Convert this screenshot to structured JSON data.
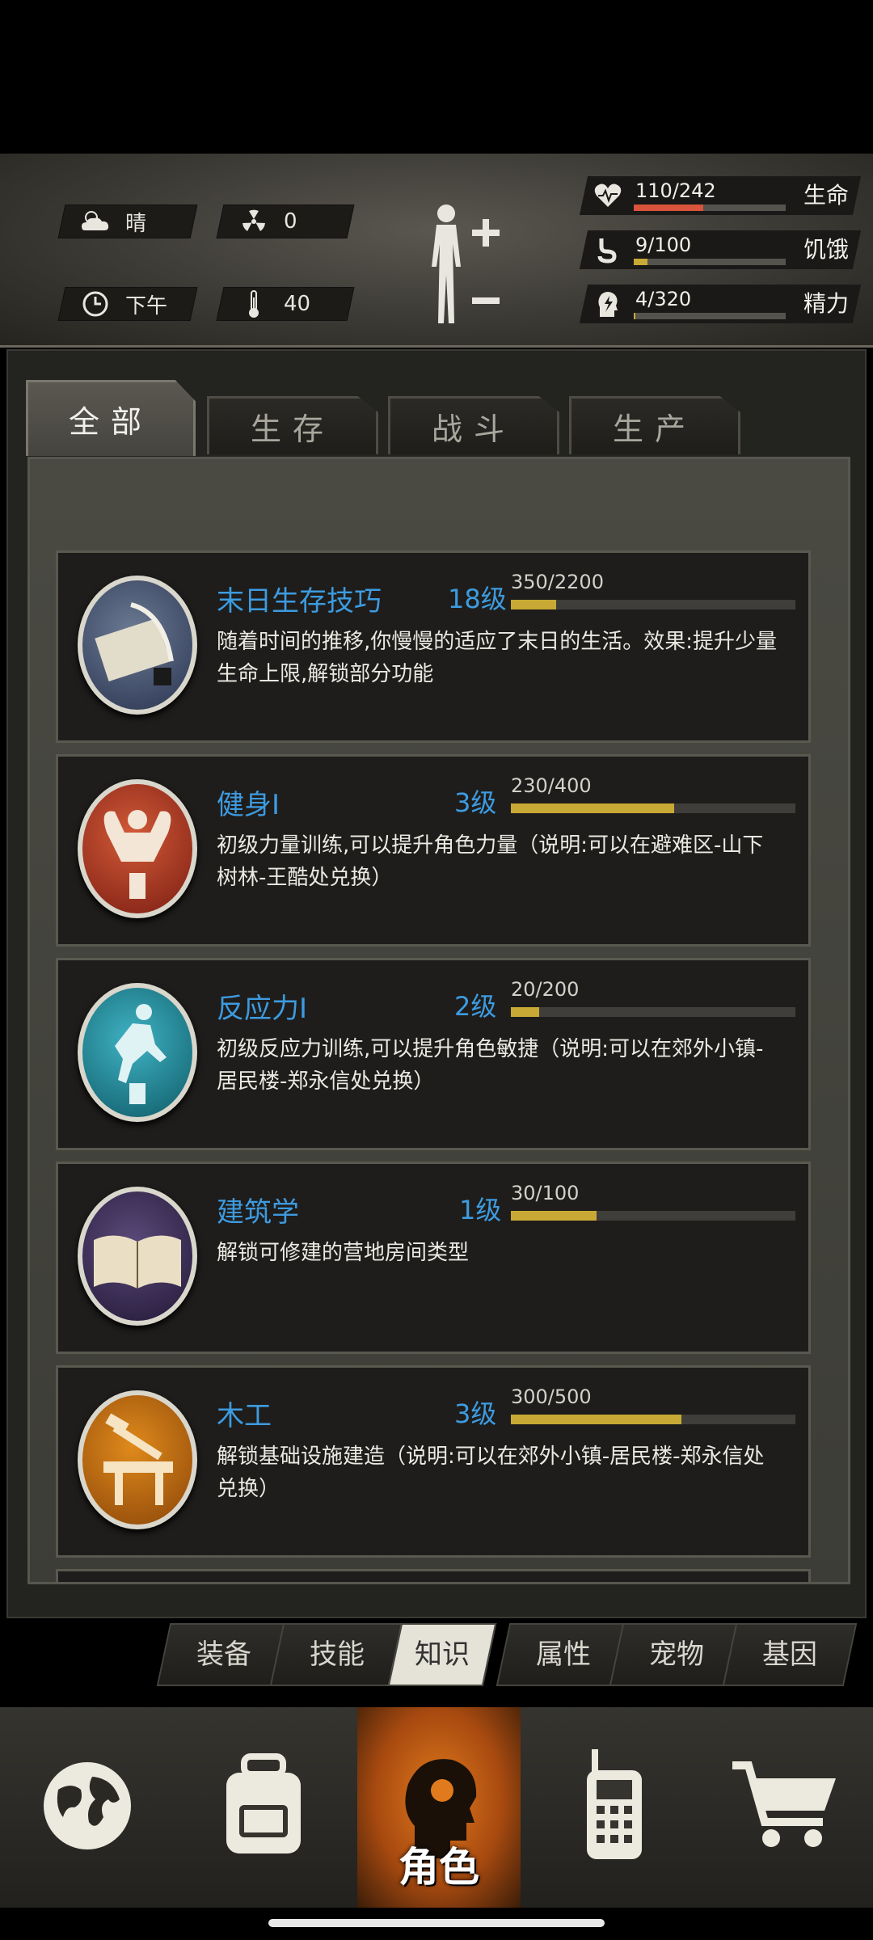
{
  "status": {
    "weather": "晴",
    "radiation": "0",
    "time_of_day": "下午",
    "temperature": "40"
  },
  "vitals": [
    {
      "label": "生命",
      "value": "110/242",
      "ratio": 0.455,
      "color": "#d9533d",
      "icon": "heart-pulse-icon"
    },
    {
      "label": "饥饿",
      "value": "9/100",
      "ratio": 0.09,
      "color": "#c9a935",
      "icon": "stomach-icon"
    },
    {
      "label": "精力",
      "value": "4/320",
      "ratio": 0.0125,
      "color": "#c9a935",
      "icon": "energy-head-icon"
    }
  ],
  "tabs": [
    "全部",
    "生存",
    "战斗",
    "生产"
  ],
  "active_tab": 0,
  "skills": [
    {
      "name": "末日生存技巧",
      "level": "18级",
      "exp": "350/2200",
      "ratio": 0.159,
      "desc": "随着时间的推移,你慢慢的适应了末日的生活。效果:提升少量生命上限,解锁部分功能",
      "icon": "scroll-quill-icon"
    },
    {
      "name": "健身Ⅰ",
      "level": "3级",
      "exp": "230/400",
      "ratio": 0.575,
      "desc": "初级力量训练,可以提升角色力量（说明:可以在避难区-山下树林-王酷处兑换）",
      "icon": "muscle-icon"
    },
    {
      "name": "反应力Ⅰ",
      "level": "2级",
      "exp": "20/200",
      "ratio": 0.1,
      "desc": "初级反应力训练,可以提升角色敏捷（说明:可以在郊外小镇-居民楼-郑永信处兑换）",
      "icon": "agility-icon"
    },
    {
      "name": "建筑学",
      "level": "1级",
      "exp": "30/100",
      "ratio": 0.3,
      "desc": "解锁可修建的营地房间类型",
      "icon": "blueprint-book-icon"
    },
    {
      "name": "木工",
      "level": "3级",
      "exp": "300/500",
      "ratio": 0.6,
      "desc": "解锁基础设施建造（说明:可以在郊外小镇-居民楼-郑永信处兑换）",
      "icon": "carpentry-icon"
    }
  ],
  "subtabs": [
    "装备",
    "技能",
    "知识",
    "属性",
    "宠物",
    "基因"
  ],
  "active_subtab": 2,
  "nav": {
    "items": [
      "globe-icon",
      "backpack-icon",
      "character-icon",
      "walkie-talkie-icon",
      "cart-icon"
    ],
    "active_label": "角色"
  }
}
